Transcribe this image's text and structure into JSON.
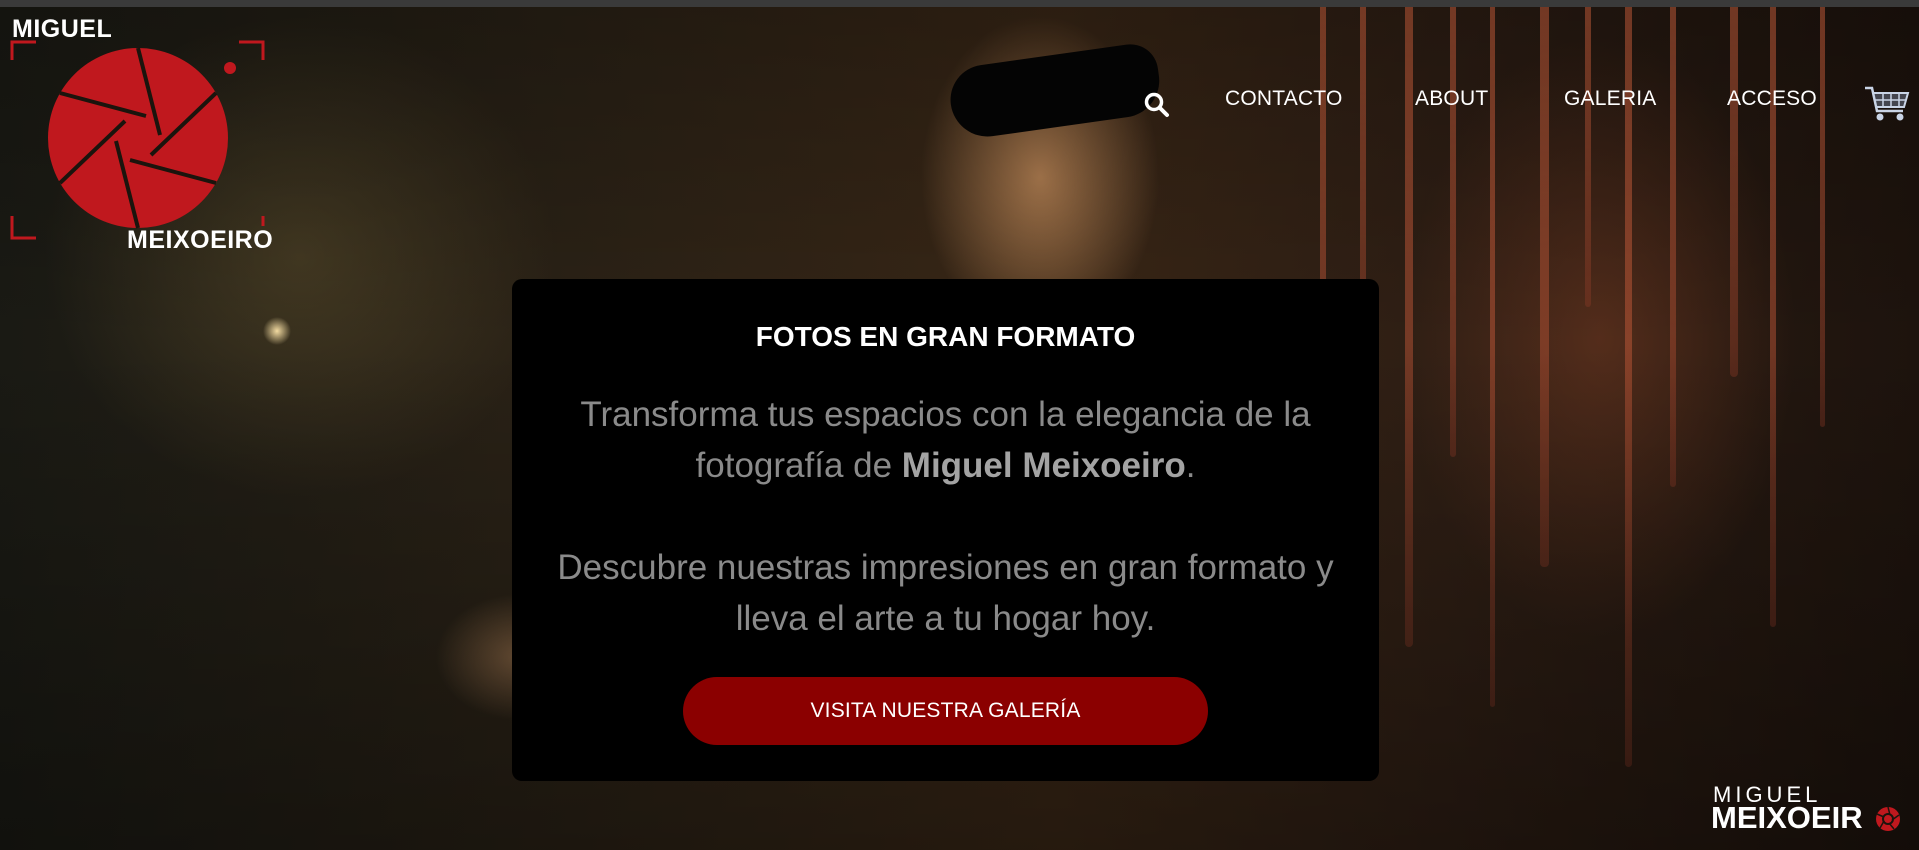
{
  "brand": {
    "logo_top": "MIGUEL",
    "logo_bottom": "MEIXOEIRO",
    "accent_color": "#c0181e",
    "corner_top": "MIGUEL",
    "corner_bottom": "MEIXOEIR"
  },
  "nav": {
    "search_icon": "search-icon",
    "items": [
      {
        "label": "CONTACTO"
      },
      {
        "label": "ABOUT"
      },
      {
        "label": "GALERIA"
      },
      {
        "label": "ACCESO"
      }
    ],
    "cart_icon": "shopping-cart-icon"
  },
  "hero": {
    "title": "FOTOS EN GRAN FORMATO",
    "p1_before": "Transforma tus espacios con la elegancia de la fotografía de ",
    "p1_bold": "Miguel Meixoeiro",
    "p1_after": ".",
    "p2": "Descubre nuestras impresiones en gran formato y lleva el arte a tu hogar hoy.",
    "cta_label": "VISITA NUESTRA GALERÍA",
    "cta_color": "#8b0000"
  }
}
